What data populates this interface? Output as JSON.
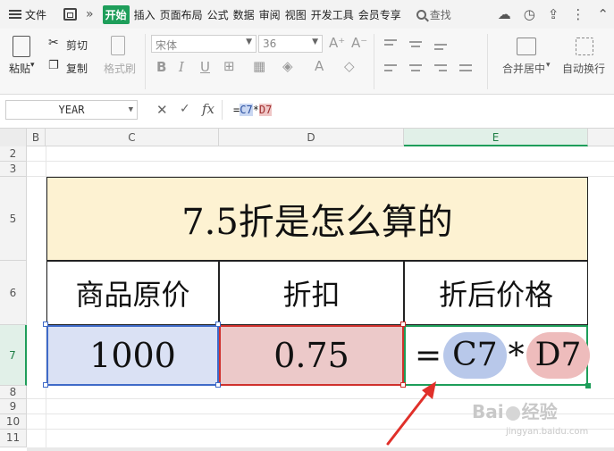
{
  "menu": {
    "file": "文件",
    "tabs": [
      "开始",
      "插入",
      "页面布局",
      "公式",
      "数据",
      "审阅",
      "视图",
      "开发工具",
      "会员专享"
    ],
    "active_tab": "开始",
    "search": "查找"
  },
  "ribbon": {
    "paste": "粘贴",
    "cut": "剪切",
    "copy": "复制",
    "format_painter": "格式刷",
    "font_name": "宋体",
    "font_size": "36",
    "merge_center": "合并居中",
    "wrap_text": "自动换行",
    "bold": "B",
    "italic": "I",
    "underline": "U"
  },
  "formula_bar": {
    "name_box": "YEAR",
    "fx": "fx",
    "formula_prefix": "=",
    "formula_ref1": "C7",
    "formula_op": "*",
    "formula_ref2": "D7"
  },
  "grid": {
    "columns": [
      "B",
      "C",
      "D",
      "E"
    ],
    "rows": [
      "2",
      "3",
      "5",
      "6",
      "7",
      "8",
      "9",
      "10",
      "11"
    ],
    "selected_column": "E",
    "selected_row": "7"
  },
  "table": {
    "title": "7.5折是怎么算的",
    "headers": [
      "商品原价",
      "折扣",
      "折后价格"
    ],
    "price": "1000",
    "discount": "0.75",
    "formula_eq": "=",
    "formula_ref1": "C7",
    "formula_op": "*",
    "formula_ref2": "D7"
  },
  "watermark": {
    "brand": "Bai",
    "brand_suffix": "经验",
    "url": "jingyan.baidu.com"
  },
  "colors": {
    "accent": "#1e9e5a",
    "ref_blue": "#3f6ac8",
    "ref_red": "#d0312d",
    "title_fill": "#fdf2d2"
  }
}
